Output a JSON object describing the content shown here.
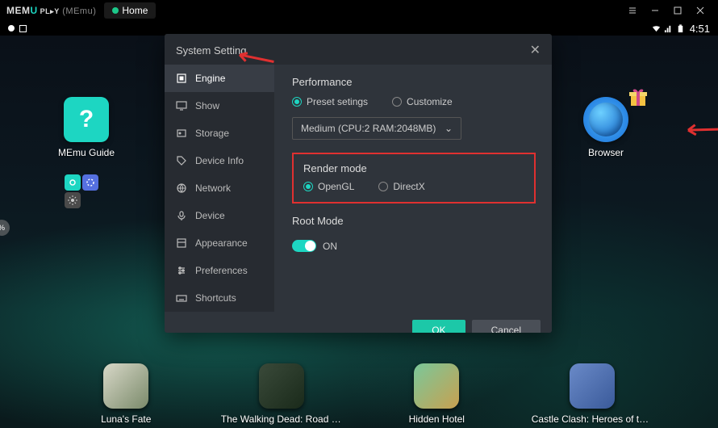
{
  "titlebar": {
    "brand_pre": "MEM",
    "brand_u": "U",
    "brand_play": " PL▸Y",
    "brand_suffix": " (MEmu)",
    "tab_home": "Home"
  },
  "statusbar": {
    "time": "4:51"
  },
  "desktop": {
    "memu_guide": "MEmu Guide",
    "browser": "Browser"
  },
  "dock": {
    "items": [
      {
        "label": "Luna's Fate"
      },
      {
        "label": "The Walking Dead: Road to..."
      },
      {
        "label": "Hidden Hotel"
      },
      {
        "label": "Castle Clash: Heroes of th..."
      }
    ]
  },
  "modal": {
    "title": "System Setting",
    "sidebar": {
      "items": [
        {
          "label": "Engine"
        },
        {
          "label": "Show"
        },
        {
          "label": "Storage"
        },
        {
          "label": "Device Info"
        },
        {
          "label": "Network"
        },
        {
          "label": "Device"
        },
        {
          "label": "Appearance"
        },
        {
          "label": "Preferences"
        },
        {
          "label": "Shortcuts"
        }
      ]
    },
    "performance": {
      "title": "Performance",
      "preset": "Preset setings",
      "customize": "Customize",
      "select_value": "Medium (CPU:2 RAM:2048MB)"
    },
    "render": {
      "title": "Render mode",
      "opengl": "OpenGL",
      "directx": "DirectX"
    },
    "root": {
      "title": "Root Mode",
      "on": "ON"
    },
    "ok": "OK",
    "cancel": "Cancel"
  }
}
